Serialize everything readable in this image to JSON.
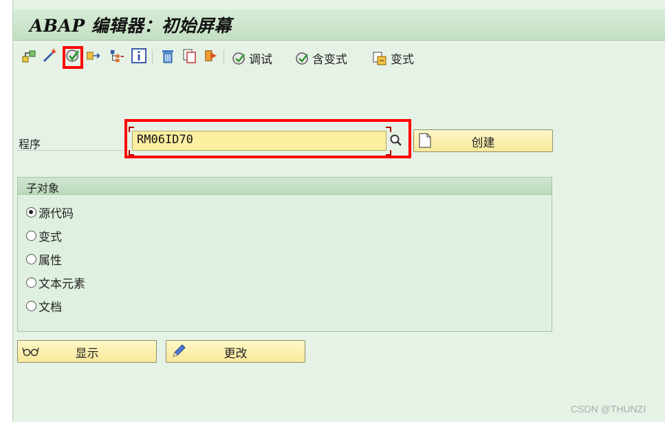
{
  "title": "ABAP 编辑器：初始屏幕",
  "toolbar": {
    "debug_label": "调试",
    "with_variant_label": "含变式",
    "variant_label": "变式"
  },
  "program": {
    "label": "程序",
    "value": "RM06ID70",
    "create_label": "创建"
  },
  "subobjects": {
    "title": "子对象",
    "options": [
      "源代码",
      "变式",
      "属性",
      "文本元素",
      "文档"
    ],
    "selected": "源代码"
  },
  "actions": {
    "display_label": "显示",
    "change_label": "更改"
  },
  "watermark": "CSDN @THUNZI",
  "colors": {
    "background": "#e6f2e6",
    "title_bar": "#c3dfc3",
    "input_background": "#fdefa0",
    "button_background": "#f8e89a",
    "highlight": "#ff0000"
  },
  "icons": [
    "object-list-icon",
    "magic-wand-icon",
    "check-icon",
    "activate-icon",
    "hierarchy-icon",
    "info-icon",
    "trash-icon",
    "copy-icon",
    "rename-icon",
    "debug-icon",
    "variant-icon"
  ]
}
